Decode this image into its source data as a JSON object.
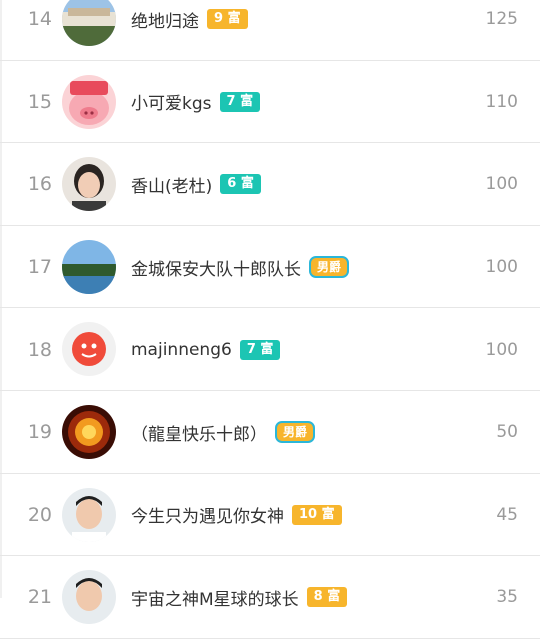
{
  "rows": [
    {
      "rank": "14",
      "name": "绝地归途",
      "badge": "9 富",
      "badge_type": "orange",
      "score": "125",
      "avatar": "landscape-building"
    },
    {
      "rank": "15",
      "name": "小可爱kgs",
      "badge": "7 富",
      "badge_type": "teal",
      "score": "110",
      "avatar": "pig"
    },
    {
      "rank": "16",
      "name": "香山(老杜)",
      "badge": "6 富",
      "badge_type": "teal",
      "score": "100",
      "avatar": "woman-photo"
    },
    {
      "rank": "17",
      "name": "金城保安大队十郎队长",
      "badge": "男爵",
      "badge_type": "title",
      "score": "100",
      "avatar": "lake"
    },
    {
      "rank": "18",
      "name": "majinneng6",
      "badge": "7 富",
      "badge_type": "teal",
      "score": "100",
      "avatar": "red-face"
    },
    {
      "rank": "19",
      "name": "（龍皇快乐十郎）",
      "badge": "男爵",
      "badge_type": "title",
      "score": "50",
      "avatar": "fire-emblem"
    },
    {
      "rank": "20",
      "name": "今生只为遇见你女神",
      "badge": "10 富",
      "badge_type": "orange",
      "score": "45",
      "avatar": "man-photo"
    },
    {
      "rank": "21",
      "name": "宇宙之神M星球的球长",
      "badge": "8 富",
      "badge_type": "orange",
      "score": "35",
      "avatar": "man-photo"
    }
  ],
  "colors": {
    "orange": "#f7b52c",
    "teal": "#1cc5b3",
    "rank_gray": "#9a9a9a"
  }
}
